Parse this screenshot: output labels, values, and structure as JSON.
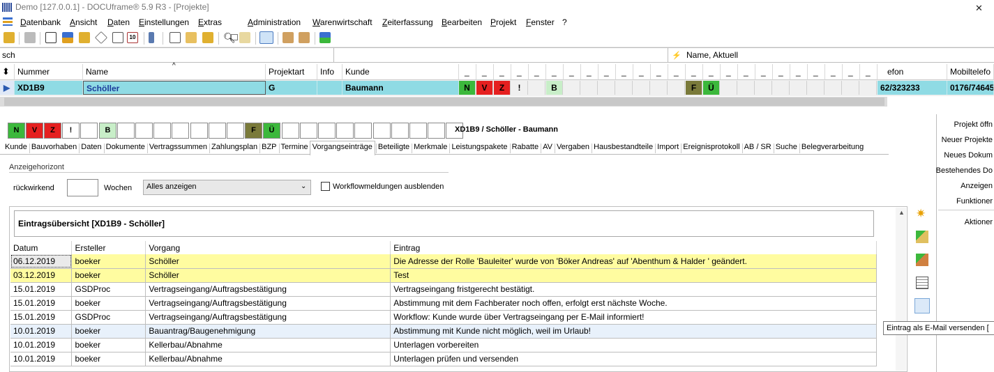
{
  "title": "Demo [127.0.0.1] - DOCUframe® 5.9 R3 - [Projekte]",
  "menu": [
    "Datenbank",
    "Ansicht",
    "Daten",
    "Einstellungen",
    "Extras",
    "Administration",
    "Warenwirtschaft",
    "Zeiterfassung",
    "Bearbeiten",
    "Projekt",
    "Fenster",
    "?"
  ],
  "search": {
    "value": "sch",
    "sort_label": "Name, Aktuell"
  },
  "grid": {
    "headers": {
      "nummer": "Nummer",
      "name": "Name",
      "projektart": "Projektart",
      "info": "Info",
      "kunde": "Kunde",
      "telefon": "efon",
      "mobil": "Mobiltelefo",
      "flag": "_"
    },
    "row": {
      "nummer": "XD1B9",
      "name": "Schöller",
      "projektart": "G",
      "info": "",
      "kunde": "Baumann",
      "telefon": "62/323233",
      "mobil": "0176/74645"
    },
    "flags": [
      {
        "t": "N",
        "bg": "#3cb83c"
      },
      {
        "t": "V",
        "bg": "#e52020"
      },
      {
        "t": "Z",
        "bg": "#e52020"
      },
      {
        "t": "!",
        "bg": "#f0f0f0"
      },
      {
        "t": "",
        "bg": "#f0f0f0"
      },
      {
        "t": "B",
        "bg": "#c8eec8"
      },
      {
        "t": "",
        "bg": "#f0f0f0"
      },
      {
        "t": "",
        "bg": "#f0f0f0"
      },
      {
        "t": "",
        "bg": "#f0f0f0"
      },
      {
        "t": "",
        "bg": "#f0f0f0"
      },
      {
        "t": "",
        "bg": "#f0f0f0"
      },
      {
        "t": "",
        "bg": "#f0f0f0"
      },
      {
        "t": "",
        "bg": "#f0f0f0"
      },
      {
        "t": "F",
        "bg": "#7a7a3a"
      },
      {
        "t": "Ü",
        "bg": "#3cb83c"
      },
      {
        "t": "",
        "bg": "#f0f0f0"
      },
      {
        "t": "",
        "bg": "#f0f0f0"
      },
      {
        "t": "",
        "bg": "#f0f0f0"
      },
      {
        "t": "",
        "bg": "#f0f0f0"
      },
      {
        "t": "",
        "bg": "#f0f0f0"
      },
      {
        "t": "",
        "bg": "#f0f0f0"
      },
      {
        "t": "",
        "bg": "#f0f0f0"
      },
      {
        "t": "",
        "bg": "#f0f0f0"
      },
      {
        "t": "",
        "bg": "#f0f0f0"
      }
    ]
  },
  "detail": {
    "flags": [
      {
        "t": "N",
        "bg": "#3cb83c"
      },
      {
        "t": "V",
        "bg": "#e52020"
      },
      {
        "t": "Z",
        "bg": "#e52020"
      },
      {
        "t": "!",
        "bg": "#ffffff"
      },
      {
        "t": "",
        "bg": "#ffffff"
      },
      {
        "t": "B",
        "bg": "#c8eec8"
      },
      {
        "t": "",
        "bg": "#ffffff"
      },
      {
        "t": "",
        "bg": "#ffffff"
      },
      {
        "t": "",
        "bg": "#ffffff"
      },
      {
        "t": "",
        "bg": "#ffffff"
      },
      {
        "t": "",
        "bg": "#ffffff"
      },
      {
        "t": "",
        "bg": "#ffffff"
      },
      {
        "t": "",
        "bg": "#ffffff"
      },
      {
        "t": "F",
        "bg": "#7a7a3a"
      },
      {
        "t": "Ü",
        "bg": "#3cb83c"
      },
      {
        "t": "",
        "bg": "#ffffff"
      },
      {
        "t": "",
        "bg": "#ffffff"
      },
      {
        "t": "",
        "bg": "#ffffff"
      },
      {
        "t": "",
        "bg": "#ffffff"
      },
      {
        "t": "",
        "bg": "#ffffff"
      },
      {
        "t": "",
        "bg": "#ffffff"
      },
      {
        "t": "",
        "bg": "#ffffff"
      },
      {
        "t": "",
        "bg": "#ffffff"
      },
      {
        "t": "",
        "bg": "#ffffff"
      },
      {
        "t": "",
        "bg": "#ffffff"
      }
    ],
    "title": "XD1B9 / Schöller - Baumann",
    "tabs": [
      "Kunde",
      "Bauvorhaben",
      "Daten",
      "Dokumente",
      "Vertragssummen",
      "Zahlungsplan",
      "BZP",
      "Termine",
      "Vorgangseinträge",
      "Beteiligte",
      "Merkmale",
      "Leistungspakete",
      "Rabatte",
      "AV",
      "Vergaben",
      "Hausbestandteile",
      "Import",
      "Ereignisprotokoll",
      "AB / SR",
      "Suche",
      "Belegverarbeitung"
    ],
    "active_tab": "Vorgangseinträge",
    "horizont_label": "Anzeigehorizont",
    "rueckwirkend": "rückwirkend",
    "rueck_value": "",
    "wochen": "Wochen",
    "select_value": "Alles anzeigen",
    "workflow_label": "Workflowmeldungen ausblenden",
    "overview_title": "Eintragsübersicht [XD1B9 - Schöller]",
    "columns": [
      "Datum",
      "Ersteller",
      "Vorgang",
      "Eintrag"
    ],
    "rows": [
      {
        "datum": "06.12.2019",
        "ersteller": "boeker",
        "vorgang": "Schöller",
        "eintrag": "Die Adresse der Rolle 'Bauleiter' wurde von 'Böker Andreas' auf 'Abenthum & Halder ' geändert.",
        "style": "hl sel"
      },
      {
        "datum": "03.12.2019",
        "ersteller": "boeker",
        "vorgang": "Schöller",
        "eintrag": "Test",
        "style": "hl"
      },
      {
        "datum": "15.01.2019",
        "ersteller": "GSDProc",
        "vorgang": "Vertragseingang/Auftragsbestätigung",
        "eintrag": "Vertragseingang fristgerecht bestätigt.",
        "style": ""
      },
      {
        "datum": "15.01.2019",
        "ersteller": "boeker",
        "vorgang": "Vertragseingang/Auftragsbestätigung",
        "eintrag": "Abstimmung mit dem Fachberater noch offen, erfolgt erst nächste Woche.",
        "style": ""
      },
      {
        "datum": "15.01.2019",
        "ersteller": "GSDProc",
        "vorgang": "Vertragseingang/Auftragsbestätigung",
        "eintrag": "Workflow: Kunde wurde über Vertragseingang per E-Mail informiert!",
        "style": ""
      },
      {
        "datum": "10.01.2019",
        "ersteller": "boeker",
        "vorgang": "Bauantrag/Baugenehmigung",
        "eintrag": "Abstimmung mit Kunde nicht möglich, weil im Urlaub!",
        "style": "hov"
      },
      {
        "datum": "10.01.2019",
        "ersteller": "boeker",
        "vorgang": "Kellerbau/Abnahme",
        "eintrag": "Unterlagen vorbereiten",
        "style": ""
      },
      {
        "datum": "10.01.2019",
        "ersteller": "boeker",
        "vorgang": "Kellerbau/Abnahme",
        "eintrag": "Unterlagen prüfen und versenden",
        "style": ""
      }
    ]
  },
  "actions": [
    "Projekt öffn",
    "Neuer Projekte",
    "Neues Dokum",
    "Bestehendes Do",
    "Anzeigen",
    "Funktioner",
    "Aktioner"
  ],
  "tooltip": "Eintrag als E-Mail versenden [",
  "icons": [
    "new-entry-icon",
    "add-entry-icon",
    "copy-entry-icon",
    "list-view-icon",
    "email-send-icon"
  ],
  "colors": {
    "selected_row": "#8fdbe4",
    "highlight_row": "#fffca0",
    "flag_green": "#3cb83c",
    "flag_red": "#e52020",
    "flag_olive": "#7a7a3a"
  }
}
